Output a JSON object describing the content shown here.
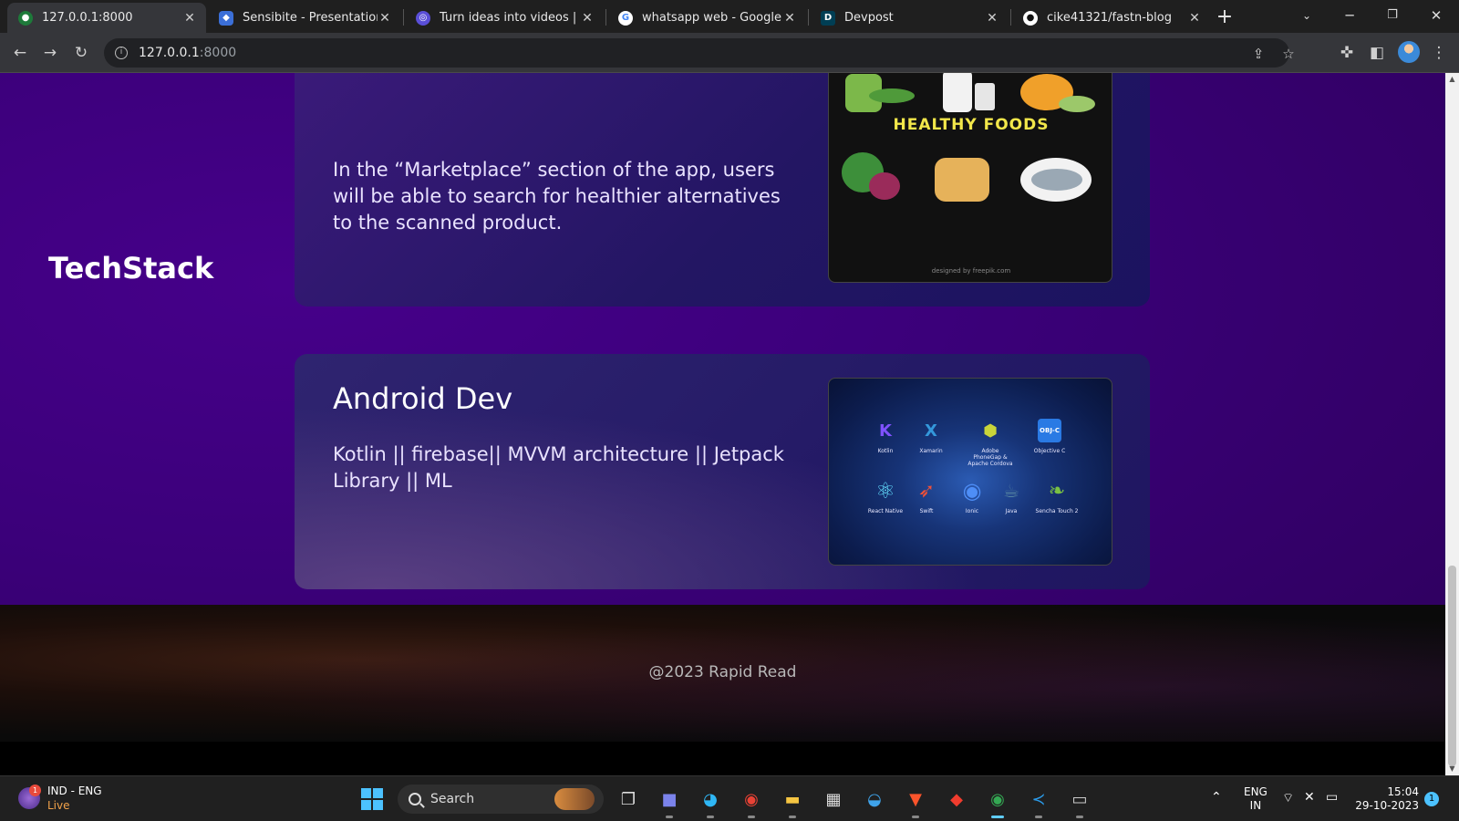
{
  "browser": {
    "tabs": [
      {
        "title": "127.0.0.1:8000",
        "favicon": "green-dot-icon"
      },
      {
        "title": "Sensibite - Presentation",
        "favicon": "shield-icon"
      },
      {
        "title": "Turn ideas into videos | AI",
        "favicon": "ai-swirl-icon"
      },
      {
        "title": "whatsapp web - Google Se",
        "favicon": "google-icon"
      },
      {
        "title": "Devpost",
        "favicon": "devpost-icon"
      },
      {
        "title": "cike41321/fastn-blog",
        "favicon": "github-icon"
      }
    ],
    "address": {
      "host": "127.0.0.1",
      "port": ":8000"
    }
  },
  "page": {
    "card1_text": "In the “Marketplace” section of the app, users will be able to search for healthier alternatives to the scanned product.",
    "card1_image_label": "HEALTHY FOODS",
    "card1_image_credit": "designed by freepik.com",
    "section_heading": "TechStack",
    "card2_title": "Android Dev",
    "card2_text": "Kotlin || firebase|| MVVM architecture || Jetpack Library || ML",
    "tech_icons": [
      {
        "label": "Kotlin",
        "glyph": "K",
        "color": "#7f52ff"
      },
      {
        "label": "Xamarin",
        "glyph": "X",
        "color": "#3498db"
      },
      {
        "label": "Adobe PhoneGap & Apache Cordova",
        "glyph": "⬢",
        "color": "#c8d43a"
      },
      {
        "label": "Objective C",
        "glyph": "OBJ-C",
        "color": "#2a7ae4"
      },
      {
        "label": "React Native",
        "glyph": "⚛",
        "color": "#61dafb"
      },
      {
        "label": "Swift",
        "glyph": "➶",
        "color": "#f05138"
      },
      {
        "label": "Ionic",
        "glyph": "◉",
        "color": "#4e8ef7"
      },
      {
        "label": "Java",
        "glyph": "☕",
        "color": "#5382a1"
      },
      {
        "label": "Sencha Touch 2",
        "glyph": "❧",
        "color": "#7ac143"
      }
    ],
    "footer": "@2023 Rapid Read"
  },
  "taskbar": {
    "weather_line1": "IND - ENG",
    "weather_line2": "Live",
    "weather_badge": "1",
    "search_label": "Search",
    "lang_line1": "ENG",
    "lang_line2": "IN",
    "time": "15:04",
    "date": "29-10-2023",
    "notification_count": "1"
  },
  "colors": {
    "page_bg": "#3b007a",
    "card_bg": "#231663",
    "accent_blue": "#4cc2ff"
  }
}
